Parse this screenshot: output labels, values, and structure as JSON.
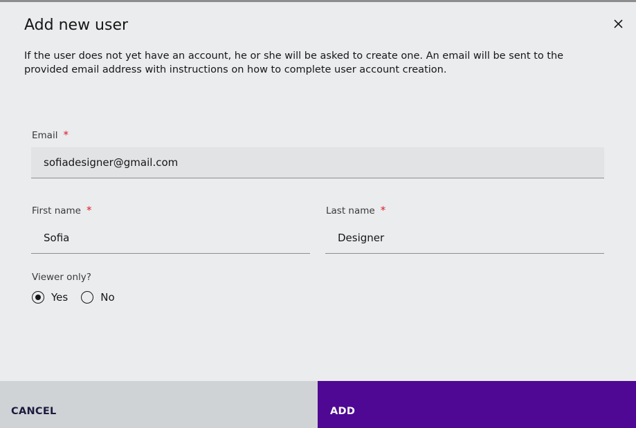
{
  "dialog": {
    "title": "Add new user",
    "description": "If the user does not yet have an account, he or she will be asked to create one. An email will be sent to the provided email address with instructions on how to complete user account creation.",
    "close_icon": "close-icon"
  },
  "form": {
    "email": {
      "label": "Email",
      "required_marker": "*",
      "value": "sofiadesigner@gmail.com"
    },
    "first_name": {
      "label": "First name",
      "required_marker": "*",
      "value": "Sofia"
    },
    "last_name": {
      "label": "Last name",
      "required_marker": "*",
      "value": "Designer"
    },
    "viewer_only": {
      "label": "Viewer only?",
      "options": [
        {
          "label": "Yes",
          "selected": true
        },
        {
          "label": "No",
          "selected": false
        }
      ]
    }
  },
  "footer": {
    "cancel_label": "CANCEL",
    "add_label": "ADD"
  },
  "colors": {
    "background": "#ebecee",
    "primary_button": "#4f0894",
    "secondary_button": "#d0d3d6",
    "required": "#da1e28"
  }
}
